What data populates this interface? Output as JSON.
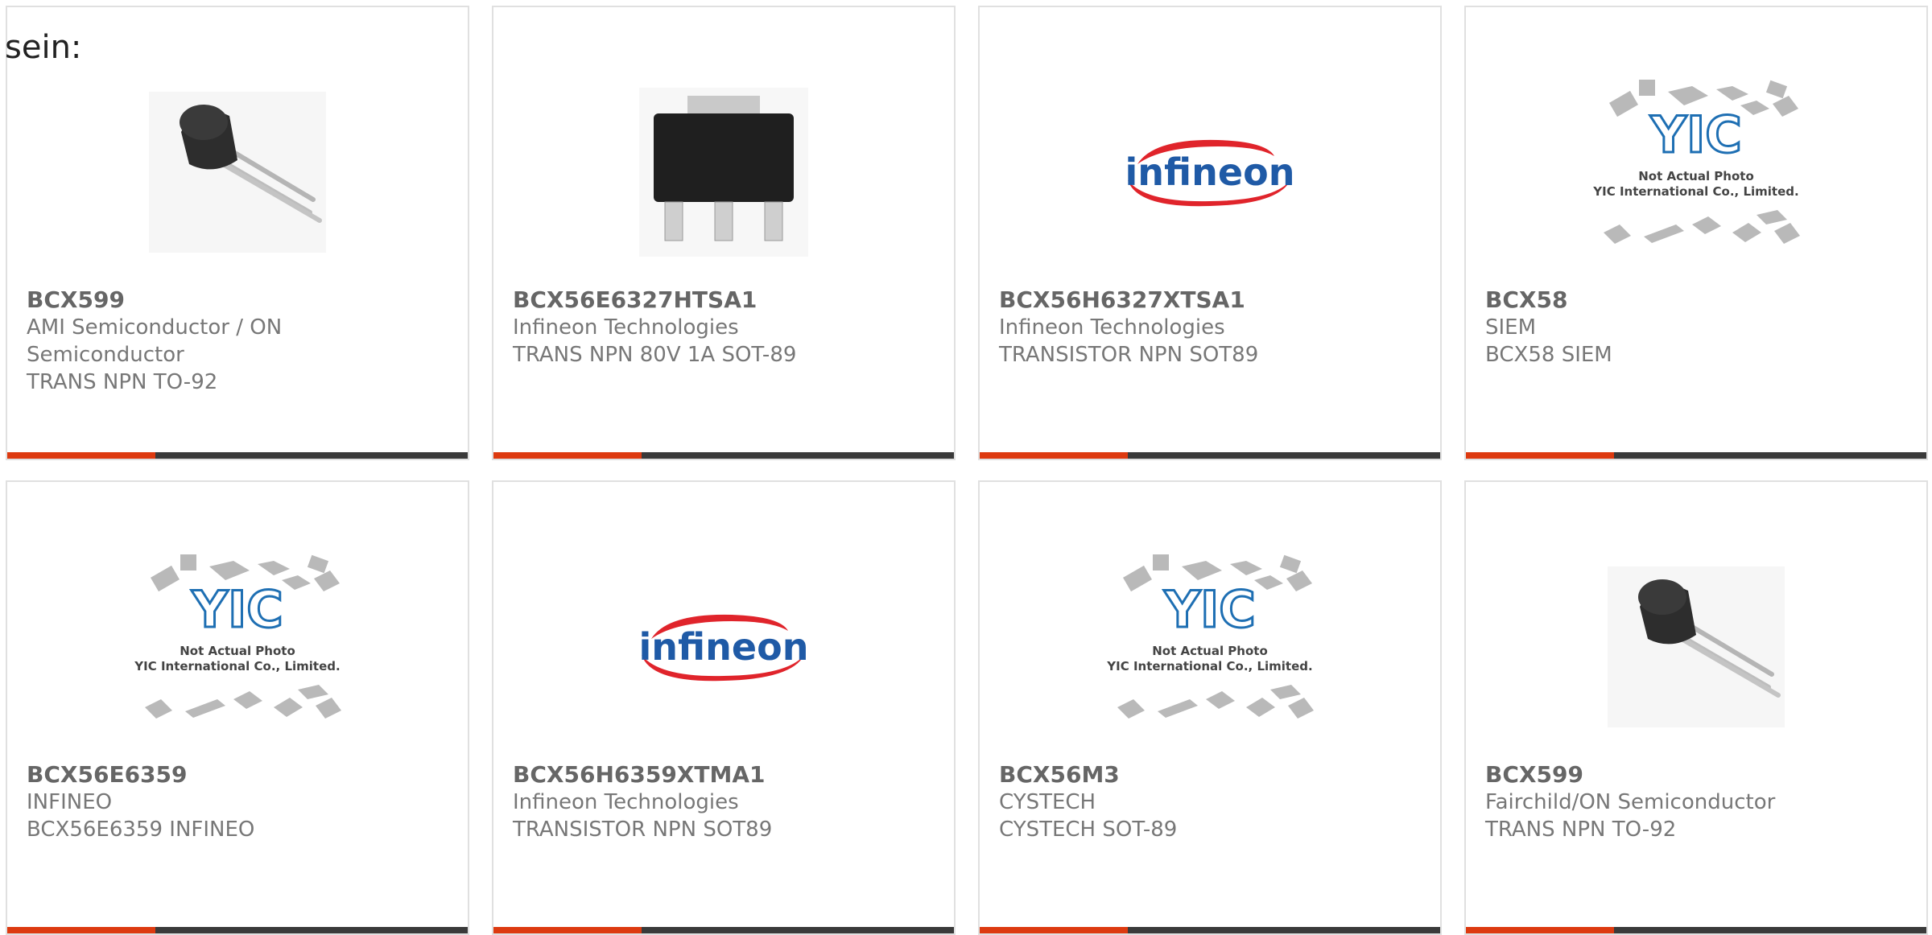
{
  "intro": "sein:",
  "colors": {
    "accent": "#dd3a10",
    "bar": "#3a3a3a",
    "border": "#e0e0e0",
    "text": "#777777",
    "infineon_red": "#e0242b",
    "infineon_blue": "#1f5aa6"
  },
  "products": [
    {
      "part": "BCX599",
      "maker": "AMI Semiconductor / ON Semiconductor",
      "desc": "TRANS NPN TO-92",
      "image": "to92-transistor-photo"
    },
    {
      "part": "BCX56E6327HTSA1",
      "maker": "Infineon Technologies",
      "desc": "TRANS NPN 80V 1A SOT-89",
      "image": "sot89-package-photo"
    },
    {
      "part": "BCX56H6327XTSA1",
      "maker": "Infineon Technologies",
      "desc": "TRANSISTOR NPN SOT89",
      "image": "infineon-logo"
    },
    {
      "part": "BCX58",
      "maker": "SIEM",
      "desc": "BCX58 SIEM",
      "image": "yic-placeholder"
    },
    {
      "part": "BCX56E6359",
      "maker": "INFINEO",
      "desc": "BCX56E6359 INFINEO",
      "image": "yic-placeholder"
    },
    {
      "part": "BCX56H6359XTMA1",
      "maker": "Infineon Technologies",
      "desc": "TRANSISTOR NPN SOT89",
      "image": "infineon-logo"
    },
    {
      "part": "BCX56M3",
      "maker": "CYSTECH",
      "desc": "CYSTECH SOT-89",
      "image": "yic-placeholder"
    },
    {
      "part": "BCX599",
      "maker": "Fairchild/ON Semiconductor",
      "desc": "TRANS NPN TO-92",
      "image": "to92-transistor-photo"
    }
  ],
  "logos": {
    "infineon": "infineon"
  },
  "placeholder": {
    "line1": "Not Actual Photo",
    "line2": "YIC International Co., Limited.",
    "brand": "YIC"
  }
}
